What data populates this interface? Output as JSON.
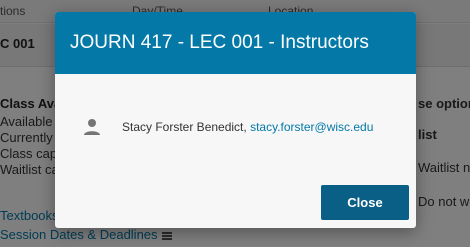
{
  "background": {
    "table_headers": [
      "tions",
      "Day/Time",
      "Location"
    ],
    "row_label": "C 001",
    "section_title": "Class Avai",
    "section_items": [
      "Available s",
      "Currently e",
      "Class capa",
      "Waitlist ca"
    ],
    "right_heading": "se option",
    "right_items": [
      "list",
      "Waitlist n",
      "Do not wa"
    ],
    "links": [
      "Textbooks",
      "Session Dates & Deadlines"
    ]
  },
  "modal": {
    "title": "JOURN 417 - LEC 001 - Instructors",
    "instructors": [
      {
        "name": "Stacy Forster Benedict, ",
        "email": "stacy.forster@wisc.edu",
        "icon": "person-icon"
      }
    ],
    "close_label": "Close"
  },
  "colors": {
    "header": "#0479a8",
    "close_button": "#0a5f86",
    "link": "#0479a8"
  }
}
